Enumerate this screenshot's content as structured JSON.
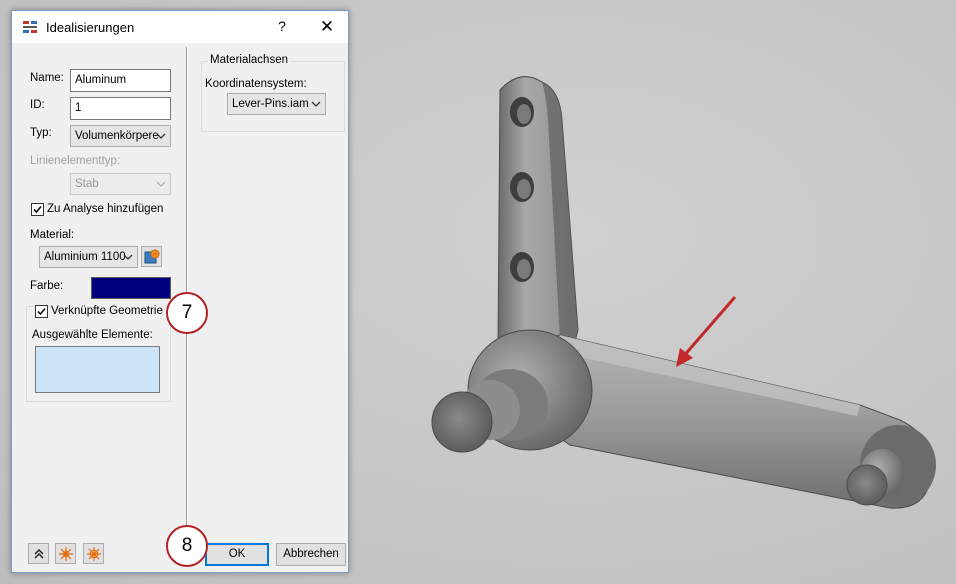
{
  "dialog": {
    "title": "Idealisierungen",
    "help_label": "?",
    "close_label": "✕"
  },
  "form": {
    "name_label": "Name:",
    "name_value": "Aluminum",
    "id_label": "ID:",
    "id_value": "1",
    "type_label": "Typ:",
    "type_value": "Volumenkörpere",
    "line_element_type_label": "Linienelementtyp:",
    "line_element_type_value": "Stab",
    "add_to_analysis_label": "Zu Analyse hinzufügen",
    "material_label": "Material:",
    "material_value": "Aluminium 1100",
    "color_label": "Farbe:",
    "linked_geometry_label": "Verknüpfte Geometrie",
    "selected_elements_label": "Ausgewählte Elemente:"
  },
  "material_axes": {
    "group_title": "Materialachsen",
    "coordinate_system_label": "Koordinatensystem:",
    "coordinate_system_value": "Lever-Pins.iam"
  },
  "footer": {
    "ok_label": "OK",
    "cancel_label": "Abbrechen"
  },
  "callouts": {
    "step_7": "7",
    "step_8": "8"
  },
  "colors": {
    "color_swatch": "#00007f",
    "arrow": "#c0282a",
    "callout_border": "#b22222",
    "accent": "#0078d7"
  },
  "icons": {
    "title": "idealization-icon",
    "material_browser": "material-browser-icon",
    "collapse": "double-chevron-up-icon",
    "settings_a": "starburst-icon",
    "settings_b": "starburst-icon"
  }
}
